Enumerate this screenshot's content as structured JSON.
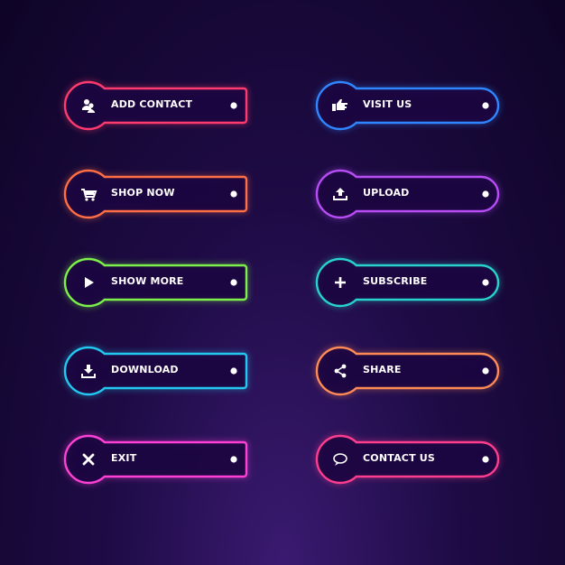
{
  "buttons": [
    {
      "label": "ADD CONTACT",
      "icon": "users-icon",
      "color": "#ff3a6e",
      "shape": "rect",
      "column": "left"
    },
    {
      "label": "SHOP NOW",
      "icon": "cart-icon",
      "color": "#ff6e45",
      "shape": "rect",
      "column": "left"
    },
    {
      "label": "SHOW MORE",
      "icon": "play-icon",
      "color": "#7ef04a",
      "shape": "rect",
      "column": "left"
    },
    {
      "label": "DOWNLOAD",
      "icon": "download-icon",
      "color": "#22c8f0",
      "shape": "rect",
      "column": "left"
    },
    {
      "label": "EXIT",
      "icon": "close-icon",
      "color": "#ff40d6",
      "shape": "rect",
      "column": "left"
    },
    {
      "label": "VISIT US",
      "icon": "thumbs-up-icon",
      "color": "#2f86ff",
      "shape": "pill",
      "column": "right"
    },
    {
      "label": "UPLOAD",
      "icon": "upload-icon",
      "color": "#b84cf5",
      "shape": "pill",
      "column": "right"
    },
    {
      "label": "SUBSCRIBE",
      "icon": "plus-icon",
      "color": "#27d3cc",
      "shape": "pill",
      "column": "right"
    },
    {
      "label": "SHARE",
      "icon": "share-icon",
      "color": "#ff8a55",
      "shape": "pill",
      "column": "right"
    },
    {
      "label": "CONTACT US",
      "icon": "chat-bubble-icon",
      "color": "#ff3d8e",
      "shape": "pill",
      "column": "right"
    }
  ]
}
